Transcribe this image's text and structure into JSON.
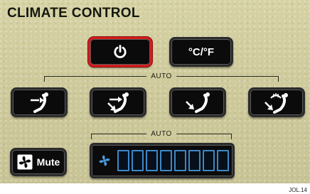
{
  "header": {
    "title": "CLIMATE CONTROL"
  },
  "controls": {
    "power": {
      "icon": "power-icon",
      "active": true,
      "accent": "#d21d1d"
    },
    "units": {
      "label": "°C/°F"
    },
    "mode_auto_label": "AUTO",
    "modes": [
      {
        "name": "face",
        "icon": "airflow-face-icon"
      },
      {
        "name": "face-and-feet",
        "icon": "airflow-face-feet-icon"
      },
      {
        "name": "feet",
        "icon": "airflow-feet-icon"
      },
      {
        "name": "feet-and-windscreen",
        "icon": "airflow-defrost-icon"
      }
    ],
    "fan_auto_label": "AUTO",
    "mute": {
      "label": "Mute",
      "icon": "fan-icon"
    },
    "fan_speed": {
      "icon": "fan-icon",
      "segments": 8,
      "level": 0,
      "color": "#3b88c9"
    }
  },
  "caption": "JOL.14"
}
